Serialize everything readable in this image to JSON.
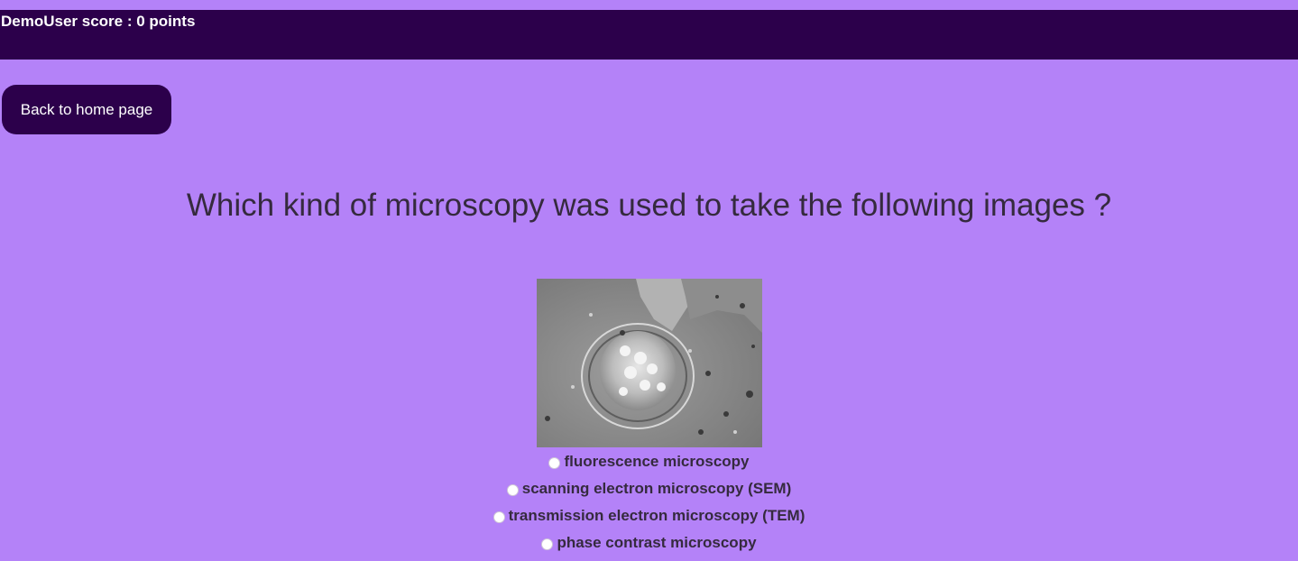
{
  "header": {
    "score_text": "DemoUser score : 0 points"
  },
  "nav": {
    "home_label": "Back to home page"
  },
  "quiz": {
    "question": "Which kind of microscopy was used to take the following images ?",
    "image_icon": "phase-contrast-cell-image",
    "options": [
      "fluorescence microscopy",
      "scanning electron microscopy (SEM)",
      "transmission electron microscopy (TEM)",
      "phase contrast microscopy"
    ]
  },
  "colors": {
    "background": "#b482f8",
    "header": "#2c004b",
    "text": "#352a3e"
  }
}
